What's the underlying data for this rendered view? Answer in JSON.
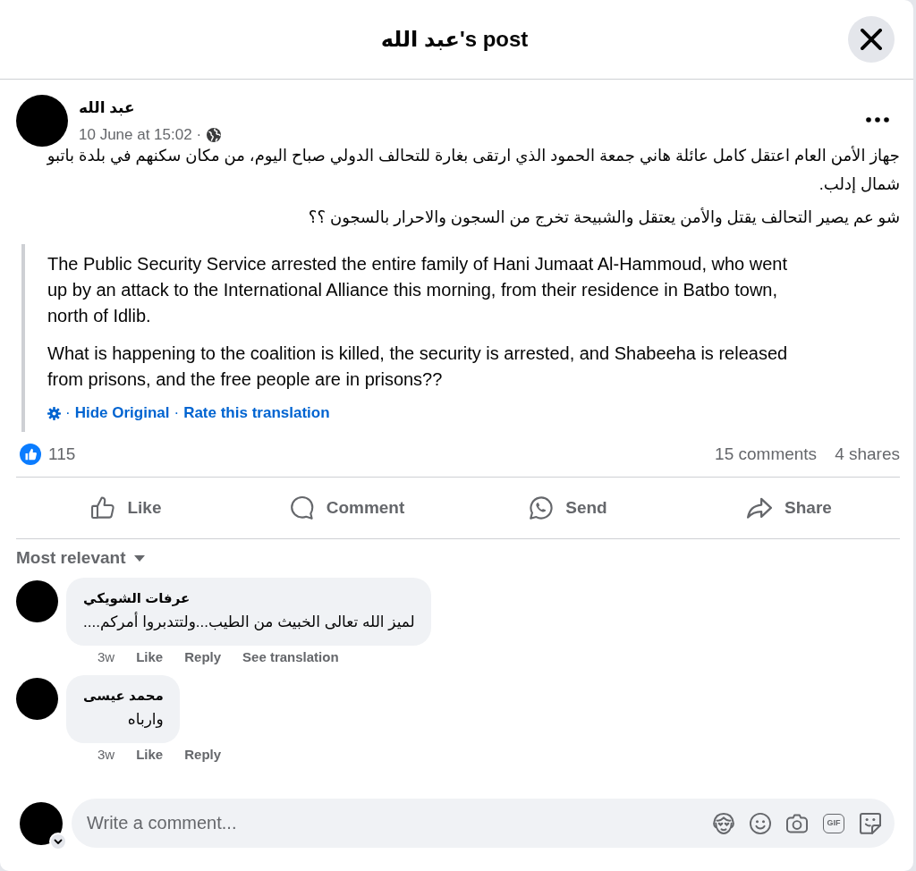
{
  "dialog": {
    "title": "عبد الله's post"
  },
  "post": {
    "author": "عبد الله",
    "timestamp": "10 June at 15:02 ·",
    "paragraphs": [
      "جهاز الأمن العام اعتقل كامل عائلة هاني جمعة الحمود الذي ارتقى بغارة للتحالف الدولي صباح اليوم، من مكان سكنهم في بلدة باتبو شمال إدلب.",
      "شو عم يصير التحالف يقتل والأمن يعتقل والشبيحة تخرج من السجون والاحرار بالسجون ؟؟"
    ],
    "translation": {
      "paragraphs": [
        "The Public Security Service arrested the entire family of Hani Jumaat Al-Hammoud, who went up by an attack to the International Alliance this morning, from their residence in Batbo town, north of Idlib.",
        "What is happening to the coalition is killed, the security is arrested, and Shabeeha is released from prisons, and the free people are in prisons??"
      ],
      "separator": "·",
      "links": [
        "Hide Original",
        "Rate this translation"
      ]
    }
  },
  "engagement": {
    "reactions": "115",
    "comments": "15 comments",
    "shares": "4 shares"
  },
  "actions": [
    {
      "kind": "like",
      "label": "Like"
    },
    {
      "kind": "comment",
      "label": "Comment"
    },
    {
      "kind": "send",
      "label": "Send"
    },
    {
      "kind": "share",
      "label": "Share"
    }
  ],
  "sort": {
    "label": "Most relevant"
  },
  "comments": [
    {
      "author": "عرفات الشويكي",
      "text": "لميز الله تعالى الخبيث من الطيب...ولتتدبروا أمركم....",
      "time": "3w",
      "actions": [
        "Like",
        "Reply",
        "See translation"
      ]
    },
    {
      "author": "محمد عيسى",
      "text": "وارباه",
      "time": "3w",
      "actions": [
        "Like",
        "Reply"
      ]
    }
  ],
  "composer": {
    "placeholder": "Write a comment...",
    "tools": [
      {
        "kind": "avatar"
      },
      {
        "kind": "emoji"
      },
      {
        "kind": "camera"
      },
      {
        "kind": "gif",
        "label": "GIF"
      },
      {
        "kind": "sticker"
      }
    ]
  }
}
